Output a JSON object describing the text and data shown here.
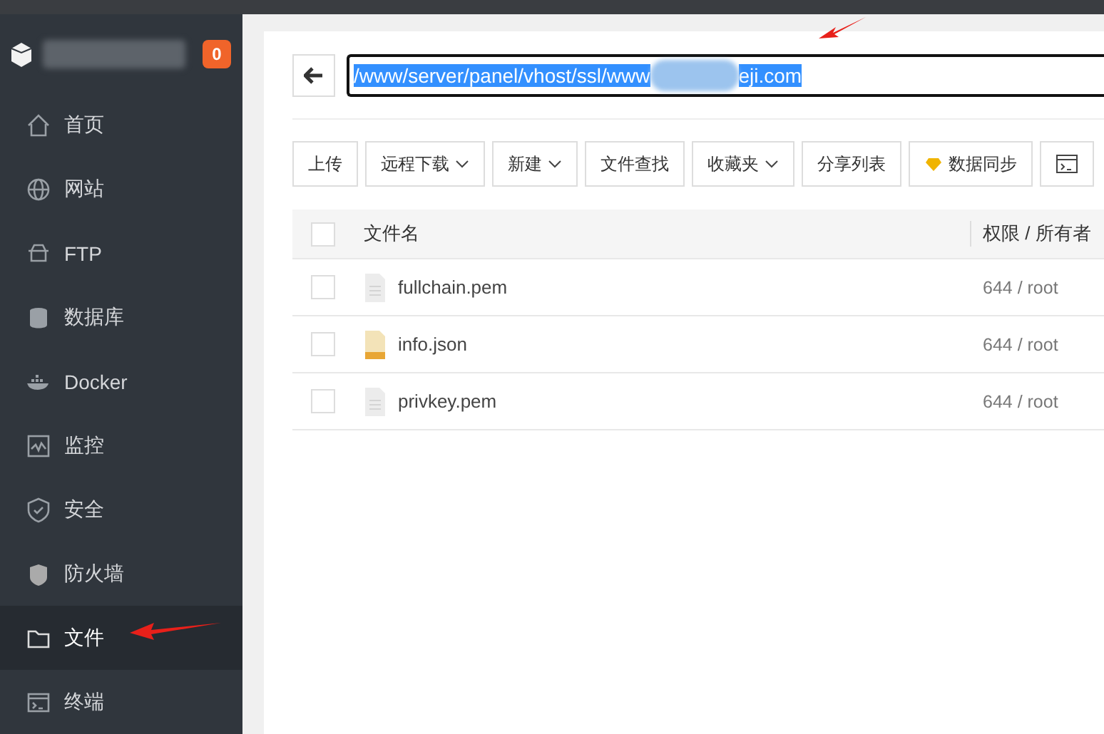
{
  "sidebar": {
    "badge": "0",
    "items": [
      {
        "label": "首页",
        "kind": "home",
        "selected": false
      },
      {
        "label": "网站",
        "kind": "globe",
        "selected": false
      },
      {
        "label": "FTP",
        "kind": "ftp",
        "selected": false
      },
      {
        "label": "数据库",
        "kind": "database",
        "selected": false
      },
      {
        "label": "Docker",
        "kind": "docker",
        "selected": false
      },
      {
        "label": "监控",
        "kind": "monitor",
        "selected": false
      },
      {
        "label": "安全",
        "kind": "shield",
        "selected": false
      },
      {
        "label": "防火墙",
        "kind": "wall",
        "selected": false
      },
      {
        "label": "文件",
        "kind": "folder",
        "selected": true
      },
      {
        "label": "终端",
        "kind": "terminal",
        "selected": false
      }
    ]
  },
  "path_bar": {
    "path_start": "/www/server/panel/vhost/ssl/www",
    "path_end": "eji.com",
    "selected": true
  },
  "toolbar": [
    {
      "label": "上传",
      "kind": "plain"
    },
    {
      "label": "远程下载",
      "kind": "dropdown"
    },
    {
      "label": "新建",
      "kind": "dropdown"
    },
    {
      "label": "文件查找",
      "kind": "plain"
    },
    {
      "label": "收藏夹",
      "kind": "dropdown"
    },
    {
      "label": "分享列表",
      "kind": "plain"
    },
    {
      "label": "数据同步",
      "kind": "sync"
    },
    {
      "kind": "terminal"
    }
  ],
  "table": {
    "columns": [
      "文件名",
      "权限 / 所有者"
    ],
    "all_checked": false,
    "rows": [
      {
        "name": "fullchain.pem",
        "kind": "file",
        "permission": "644 / root",
        "checked": false
      },
      {
        "name": "info.json",
        "kind": "json",
        "permission": "644 / root",
        "checked": false
      },
      {
        "name": "privkey.pem",
        "kind": "file",
        "permission": "644 / root",
        "checked": false
      }
    ]
  }
}
